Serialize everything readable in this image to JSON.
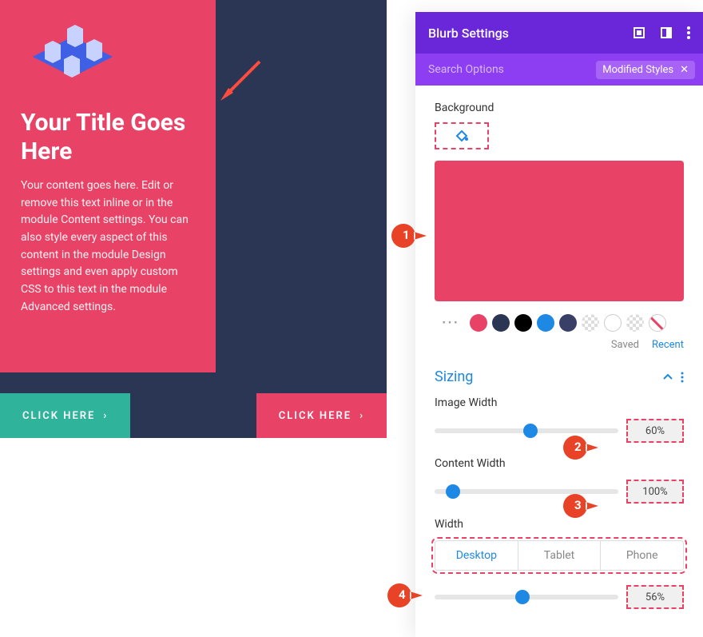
{
  "preview": {
    "title": "Your Title Goes Here",
    "body": "Your content goes here. Edit or remove this text inline or in the module Content settings. You can also style every aspect of this content in the module Design settings and even apply custom CSS to this text in the module Advanced settings.",
    "btn1": "CLICK HERE",
    "btn2": "CLICK HERE"
  },
  "panel": {
    "title": "Blurb Settings",
    "search_placeholder": "Search Options",
    "filter_chip": "Modified Styles",
    "bg_label": "Background",
    "saved": "Saved",
    "recent": "Recent",
    "section": "Sizing",
    "image_width_label": "Image Width",
    "image_width_val": "60%",
    "content_width_label": "Content Width",
    "content_width_val": "100%",
    "width_label": "Width",
    "tabs": {
      "desktop": "Desktop",
      "tablet": "Tablet",
      "phone": "Phone"
    },
    "width_val": "56%"
  },
  "colors": {
    "pink": "#e84266",
    "navy": "#2b3554",
    "black": "#000000",
    "blue": "#1e88e5",
    "darknavy": "#3a3f68"
  },
  "callouts": {
    "c1": "1",
    "c2": "2",
    "c3": "3",
    "c4": "4"
  }
}
